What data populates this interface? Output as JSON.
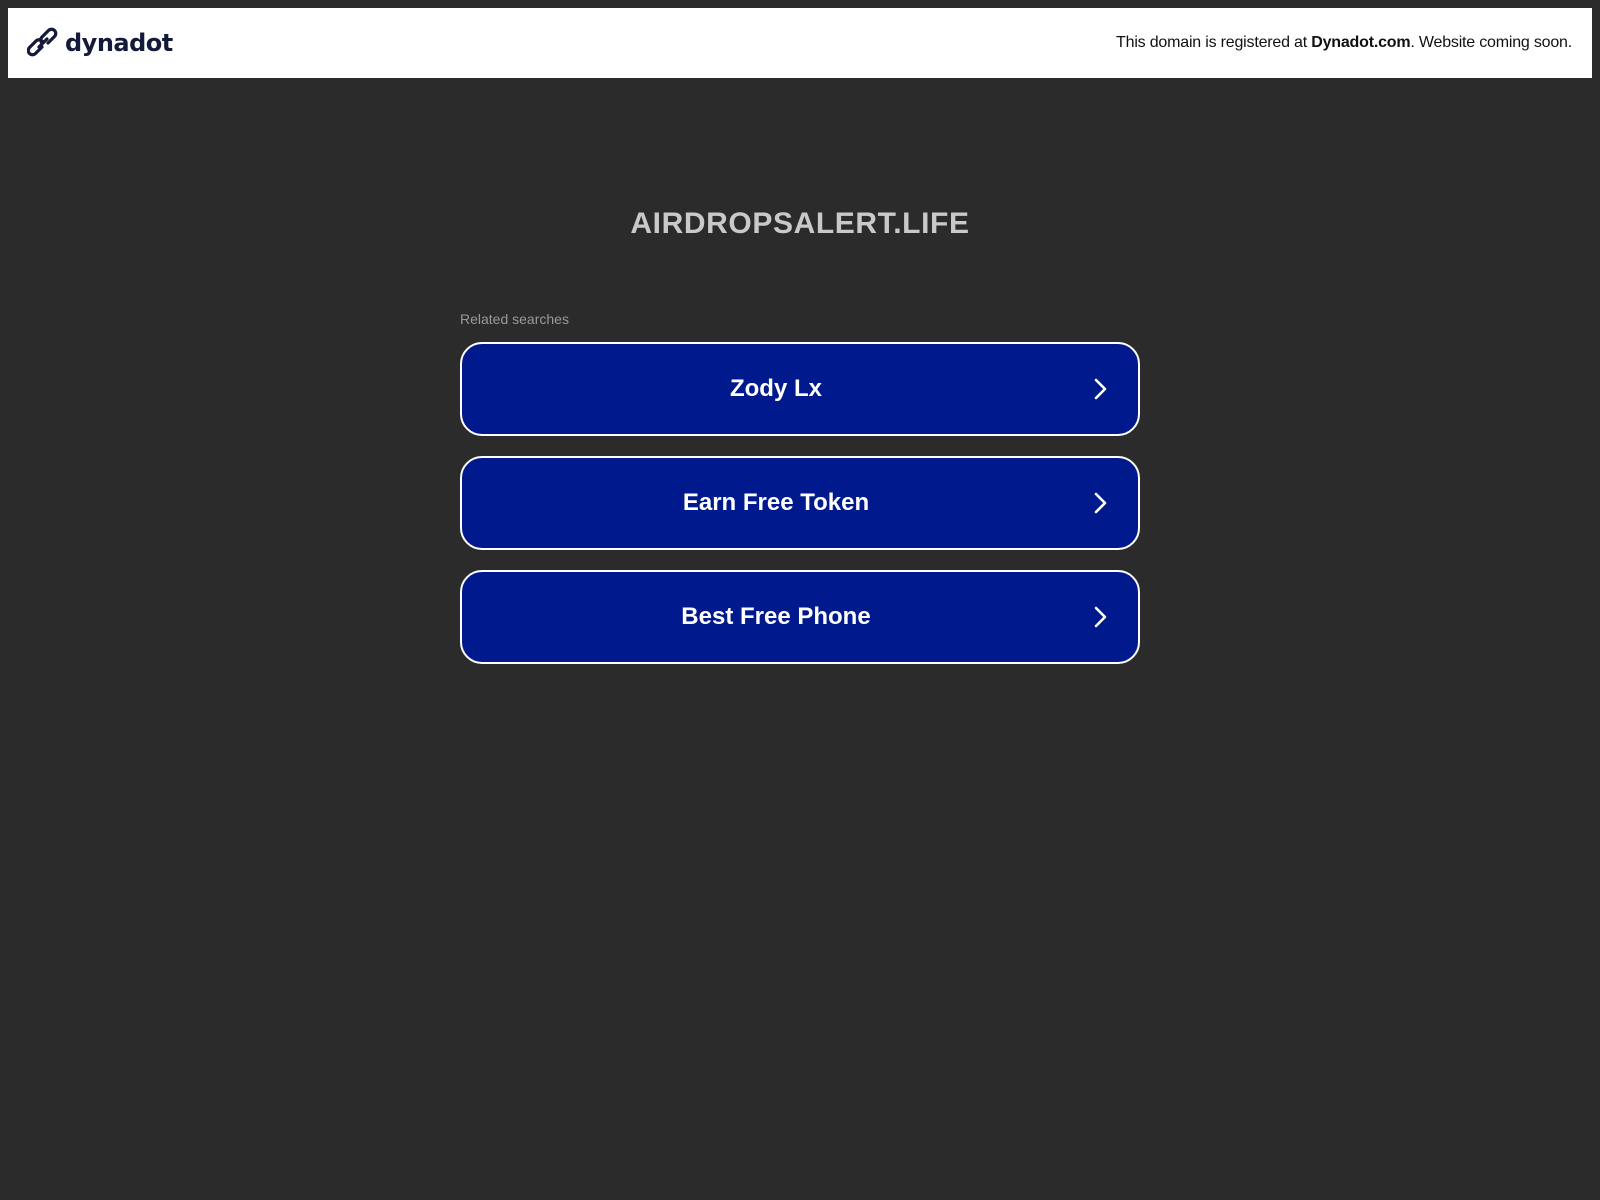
{
  "header": {
    "brand_name": "dynadot",
    "notice_prefix": "This domain is registered at ",
    "notice_link": "Dynadot.com",
    "notice_suffix": ". Website coming soon."
  },
  "main": {
    "domain": "AIRDROPSALERT.LIFE",
    "related_label": "Related searches",
    "searches": [
      {
        "label": "Zody Lx"
      },
      {
        "label": "Earn Free Token"
      },
      {
        "label": "Best Free Phone"
      }
    ]
  },
  "icons": {
    "logo": "chain-link-icon",
    "search_arrow": "chevron-right-icon"
  },
  "colors": {
    "background": "#2b2b2b",
    "topbar": "#ffffff",
    "button": "#001a8d",
    "button_border": "#ffffff",
    "brand": "#15193a",
    "domain_text": "#c9c9c9"
  }
}
